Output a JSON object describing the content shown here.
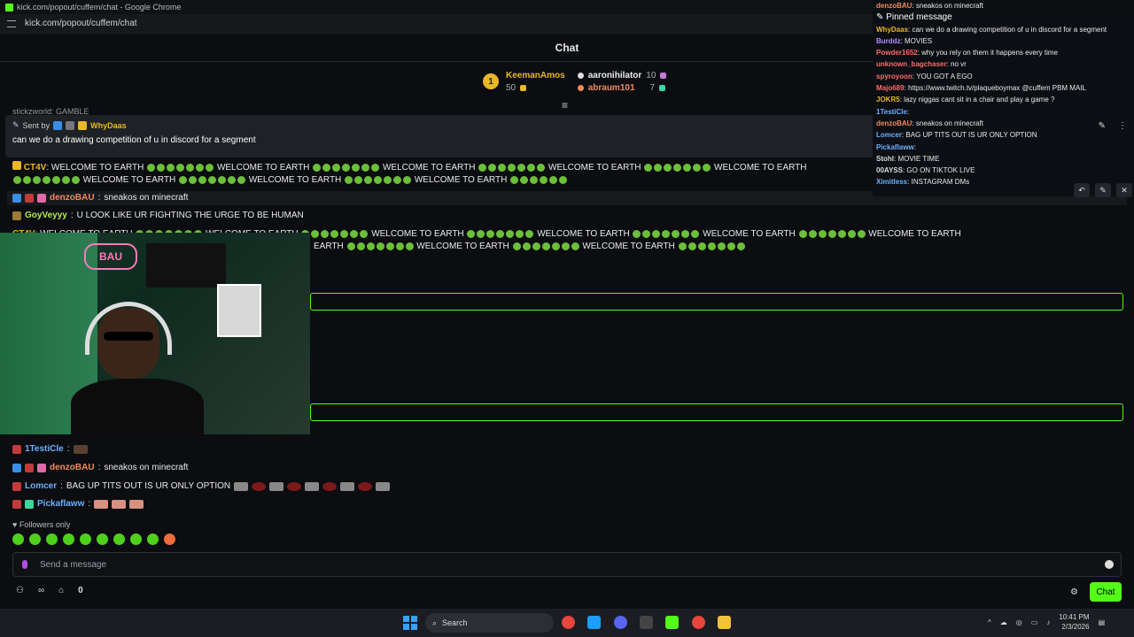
{
  "browser": {
    "title": "kick.com/popout/cuffem/chat - Google Chrome",
    "url": "kick.com/popout/cuffem/chat"
  },
  "header": {
    "title": "Chat"
  },
  "leaderboard": {
    "rank": "1",
    "first_name": "KeemanAmos",
    "first_value": "50",
    "second_name": "aaronihilator",
    "second_value": "10",
    "third_name": "abraum101",
    "third_value": "7"
  },
  "cut_line": "stickzworld: GAMBLE",
  "pinned": {
    "sent_by": "Sent by",
    "user": "WhyDaas",
    "message": "can we do a drawing competition of u in discord for a segment"
  },
  "messages": [
    {
      "user": "CT4V",
      "text": "WELCOME TO EARTH",
      "color": "#e8b72a"
    },
    {
      "user": "denzoBAU",
      "text": "sneakos on minecraft",
      "color": "#f08a5d"
    },
    {
      "user": "GoyVeyyy",
      "text": "U LOOK LIKE UR FIGHTING THE URGE TO BE HUMAN",
      "color": "#b5e853"
    },
    {
      "user": "CT4V",
      "text": "WELCOME TO EARTH",
      "color": "#e8b72a"
    },
    {
      "user": "1TestiCle",
      "text": "",
      "color": "#6ab0ff"
    },
    {
      "user": "denzoBAU",
      "text": "sneakos on minecraft",
      "color": "#f08a5d"
    },
    {
      "user": "Lomcer",
      "text": "BAG UP TITS OUT IS UR ONLY OPTION",
      "color": "#6ab0ff"
    },
    {
      "user": "Pickaflaww",
      "text": "",
      "color": "#6ab0ff"
    }
  ],
  "welcome_phrase": "WELCOME TO EARTH",
  "webcam": {
    "neon_text": "BAU"
  },
  "overlay": {
    "pinned_label": "Pinned message",
    "lines": [
      {
        "user": "denzoBAU",
        "text": "sneakos on minecraft",
        "color": "#f08a5d"
      },
      {
        "user": "WhyDaas",
        "text": "can we do a drawing competition of u in discord for a segment",
        "color": "#e8b72a"
      },
      {
        "user": "Burddz",
        "text": "MOVIES",
        "color": "#b38cff"
      },
      {
        "user": "Powder1652",
        "text": "why you rely on them it happens every time",
        "color": "#ff6b6b"
      },
      {
        "user": "unknown_bagchaser",
        "text": "no vr",
        "color": "#ff6b6b"
      },
      {
        "user": "spyroyoon",
        "text": "YOU GOT A EGO",
        "color": "#ff6b6b"
      },
      {
        "user": "Majo689",
        "text": "https://www.twitch.tv/plaqueboymax @cuffem PBM MAIL",
        "color": "#ff6b6b"
      },
      {
        "user": "JOKR5",
        "text": "lazy niggas cant sit in a chair and play a game ?",
        "color": "#e8b72a"
      },
      {
        "user": "1TestiCle",
        "text": "",
        "color": "#6ab0ff"
      },
      {
        "user": "denzoBAU",
        "text": "sneakos on minecraft",
        "color": "#f08a5d"
      },
      {
        "user": "Lomcer",
        "text": "BAG UP TITS OUT IS UR ONLY OPTION",
        "color": "#6ab0ff"
      },
      {
        "user": "Pickaflaww",
        "text": "",
        "color": "#6ab0ff"
      },
      {
        "user": "Stohl",
        "text": "MOVIE TIME",
        "color": "#ddd"
      },
      {
        "user": "00AYSS",
        "text": "GO ON TIKTOK LIVE",
        "color": "#ddd"
      },
      {
        "user": "Ximitless",
        "text": "INSTAGRAM DMs",
        "color": "#6ab0ff"
      }
    ]
  },
  "followers_only": "Followers only",
  "input": {
    "placeholder": "Send a message"
  },
  "bottom": {
    "count": "0",
    "chat_button": "Chat"
  },
  "taskbar": {
    "search": "Search",
    "time": "10:41 PM",
    "date": "2/3/2026"
  }
}
